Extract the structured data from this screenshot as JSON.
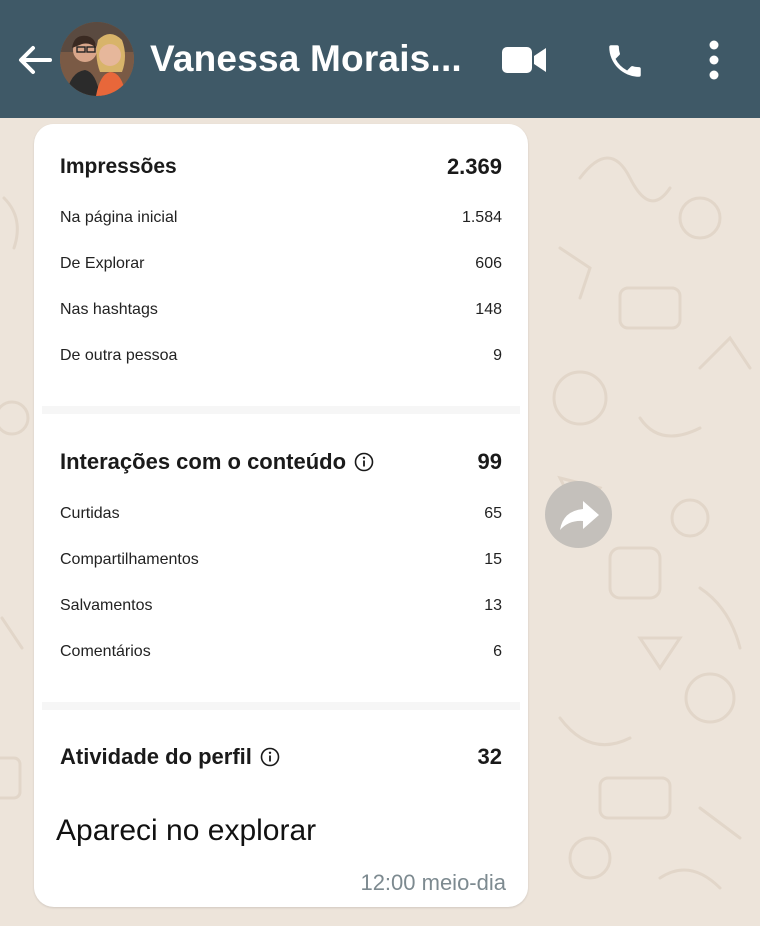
{
  "header": {
    "contact_name": "Vanessa Morais...",
    "bg_color": "#3f5967"
  },
  "icons": {
    "back": "arrow-left-icon",
    "video": "video-camera-icon",
    "call": "phone-icon",
    "menu": "more-vertical-icon",
    "forward": "forward-icon",
    "info": "info-circle-icon"
  },
  "insights": {
    "impressions": {
      "label": "Impressões",
      "value": "2.369",
      "rows": [
        {
          "label": "Na página inicial",
          "value": "1.584"
        },
        {
          "label": "De Explorar",
          "value": "606"
        },
        {
          "label": "Nas hashtags",
          "value": "148"
        },
        {
          "label": "De outra pessoa",
          "value": "9"
        }
      ]
    },
    "interactions": {
      "label": "Interações com o conteúdo",
      "value": "99",
      "rows": [
        {
          "label": "Curtidas",
          "value": "65"
        },
        {
          "label": "Compartilhamentos",
          "value": "15"
        },
        {
          "label": "Salvamentos",
          "value": "13"
        },
        {
          "label": "Comentários",
          "value": "6"
        }
      ]
    },
    "profile_activity": {
      "label": "Atividade do perfil",
      "value": "32"
    }
  },
  "message": {
    "caption": "Apareci no explorar",
    "time": "12:00 meio-dia"
  },
  "colors": {
    "wallpaper": "#ede4da",
    "bubble": "#ffffff",
    "timestamp": "#7d8a90"
  }
}
